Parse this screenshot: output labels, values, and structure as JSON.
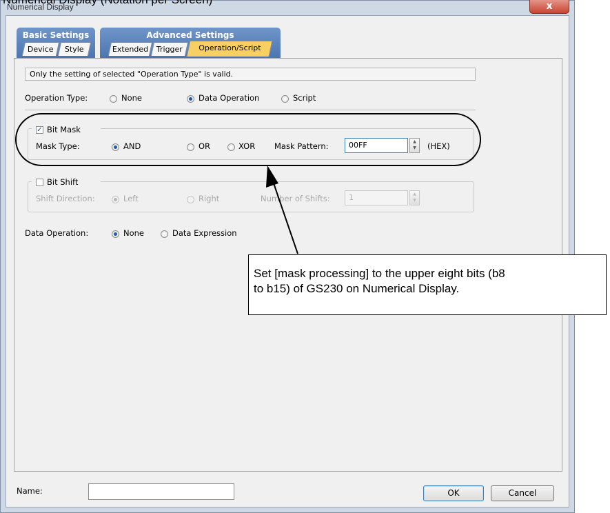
{
  "caption": "Numerical Display (Notation per Screen)",
  "window": {
    "title": "Numerical Display",
    "close_label": "x"
  },
  "tab_groups": [
    {
      "label": "Basic Settings",
      "tabs": [
        "Device",
        "Style"
      ]
    },
    {
      "label": "Advanced Settings",
      "tabs": [
        "Extended",
        "Trigger",
        "Operation/Script"
      ],
      "active": "Operation/Script"
    }
  ],
  "info_text": "Only the setting of selected \"Operation Type\" is valid.",
  "operation_type": {
    "label": "Operation Type:",
    "options": [
      "None",
      "Data Operation",
      "Script"
    ],
    "selected": "Data Operation"
  },
  "bit_mask": {
    "checkbox_label": "Bit Mask",
    "checked": true,
    "mask_type_label": "Mask Type:",
    "mask_type_options": [
      "AND",
      "OR",
      "XOR"
    ],
    "mask_type_selected": "AND",
    "pattern_label": "Mask Pattern:",
    "pattern_value": "00FF",
    "unit": "(HEX)"
  },
  "bit_shift": {
    "checkbox_label": "Bit Shift",
    "checked": false,
    "direction_label": "Shift Direction:",
    "direction_options": [
      "Left",
      "Right"
    ],
    "direction_selected": "Left",
    "shifts_label": "Number of Shifts:",
    "shifts_value": "1"
  },
  "data_operation": {
    "label": "Data Operation:",
    "options": [
      "None",
      "Data Expression"
    ],
    "selected": "None"
  },
  "callout": {
    "line1": "Set [mask processing] to the upper eight bits (b8",
    "line2": "to b15) of GS230 on Numerical Display."
  },
  "footer": {
    "name_label": "Name:",
    "name_value": "",
    "ok_label": "OK",
    "cancel_label": "Cancel"
  },
  "colors": {
    "accent": "#4b74b0",
    "active_tab": "#f8cf63",
    "radio_dot": "#1f5aa6"
  }
}
